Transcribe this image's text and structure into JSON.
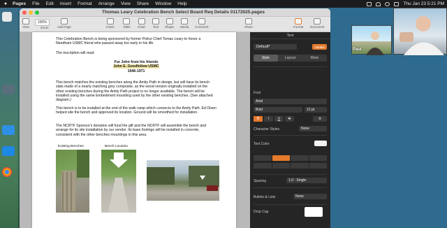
{
  "menubar": {
    "app": "Pages",
    "items": [
      "File",
      "Edit",
      "Insert",
      "Format",
      "Arrange",
      "View",
      "Share",
      "Window",
      "Help"
    ],
    "clock": "Thu Jan 23  5:21 PM"
  },
  "window": {
    "title": "Thomas Leary Celebration Bench Select Board Req Details 01172025.pages",
    "zoom": "100%",
    "toolbar": {
      "view": "View",
      "zoom": "Zoom",
      "add_page": "Add Page",
      "insert": "Insert",
      "table": "Table",
      "chart": "Chart",
      "text": "Text",
      "shape": "Shape",
      "media": "Media",
      "comment": "Comment",
      "share": "Share",
      "format": "Format",
      "document": "Document"
    }
  },
  "document": {
    "p1": "This Celebration Bench is being sponsored by former Police Chief Tomas Leary to honor a Needham USMC friend who passed away too early in his life.",
    "p2": "The inscription will read:",
    "inscription": [
      "For John from his friends",
      "John E. Goodfellow USMC",
      "1946-1971"
    ],
    "p3": "This bench matches the existing benches along the Amity Path in design, but will have its bench slats made of a nearly matching grey composite, as the wood version originally installed on the other existing benches during the Amity Path project is no longer available. The bench will be installed using the same Embedment mounting used by the other existing benches. (See attached diagram.)",
    "p4": "This bench is to be installed at the end of the walk ramp which connects to the Amity Path. Ed Olsen helped site the bench and approved its location. Ground will be smoothed for installation.",
    "p5": "The NCRTF Sponsor's donation will fund the gift and the NCRTF will assemble the bench and arrange for its site installation by our vendor. Its base footings will be installed in concrete, consistent with the other benches mountings in this area.",
    "caption_existing": "Existing Benches",
    "caption_location": "Bench Location"
  },
  "inspector": {
    "header": "Text",
    "paragraph_style": "Default*",
    "update_label": "Update",
    "tabs": [
      "Style",
      "Layout",
      "More"
    ],
    "font_label": "Font",
    "font_name": "Arial",
    "font_weight": "Bold",
    "font_size": "12 pt",
    "format_buttons": [
      "B",
      "I",
      "U",
      "S"
    ],
    "char_styles_label": "Character Styles",
    "char_styles_value": "None",
    "text_color_label": "Text Color",
    "spacing_label": "Spacing",
    "spacing_value": "1.0 - Single",
    "bullets_label": "Bullets & Lists",
    "bullets_value": "None",
    "drop_cap_label": "Drop Cap"
  },
  "video": {
    "participant": "Paul"
  },
  "colors": {
    "accent": "#e47a2c",
    "highlight": "#f3e7a8"
  }
}
